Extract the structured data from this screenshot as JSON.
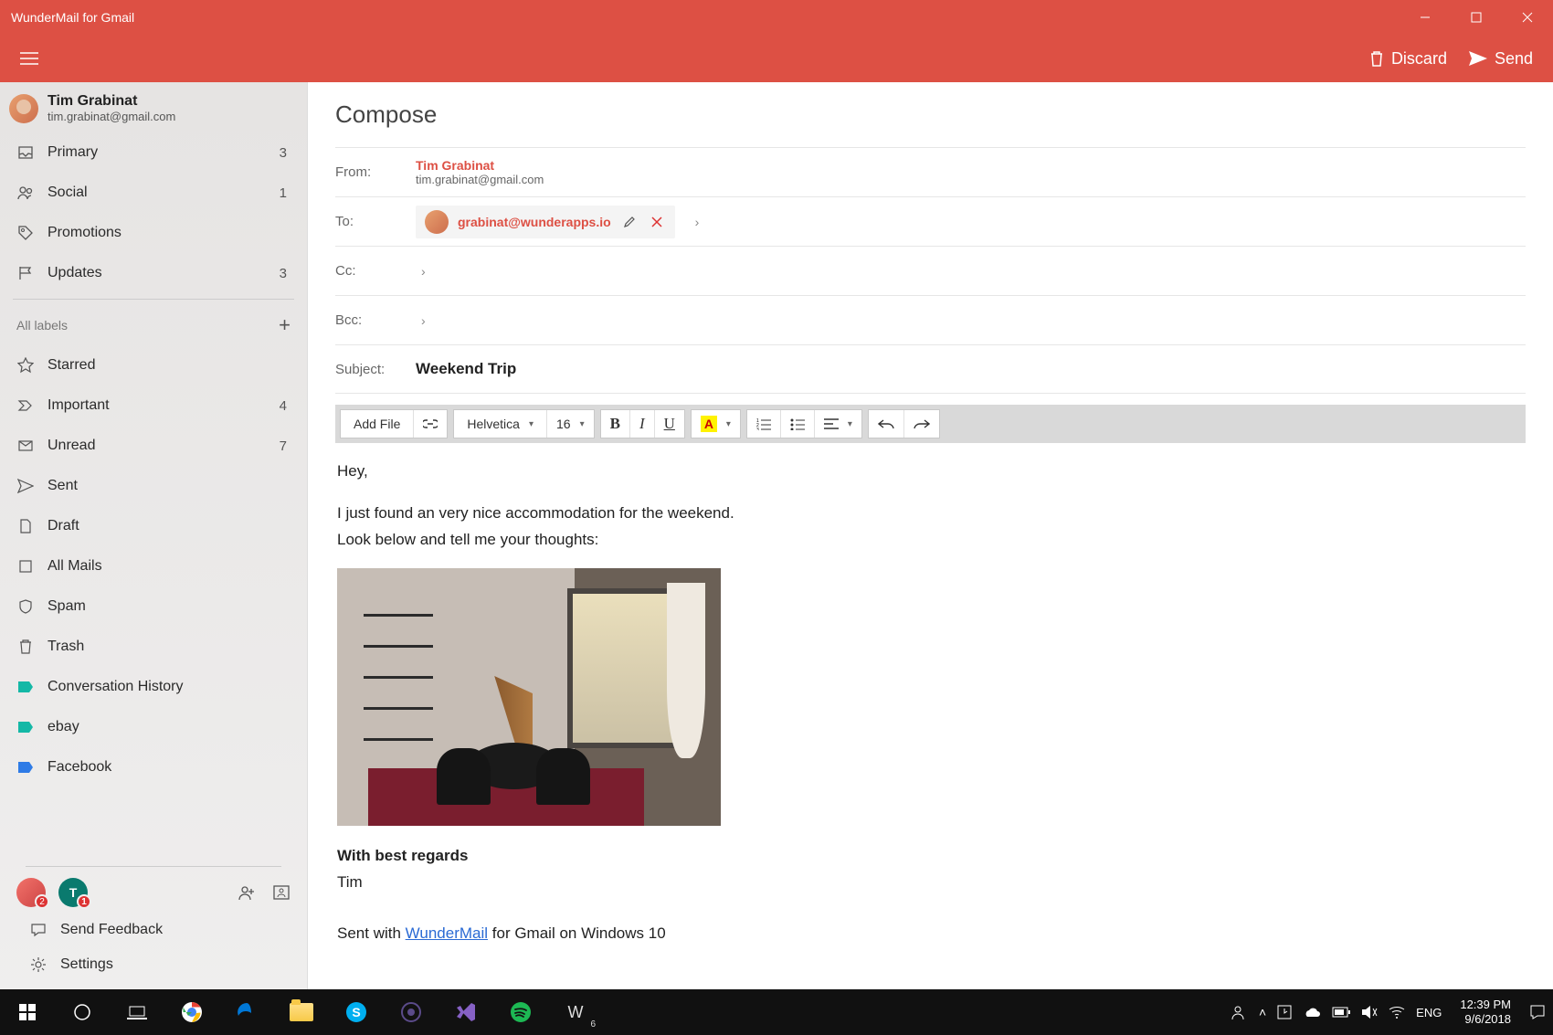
{
  "app": {
    "title": "WunderMail for Gmail"
  },
  "toolbar": {
    "discard": "Discard",
    "send": "Send"
  },
  "account": {
    "name": "Tim Grabinat",
    "email": "tim.grabinat@gmail.com"
  },
  "sidebar": {
    "items": [
      {
        "label": "Primary",
        "count": "3"
      },
      {
        "label": "Social",
        "count": "1"
      },
      {
        "label": "Promotions",
        "count": ""
      },
      {
        "label": "Updates",
        "count": "3"
      }
    ],
    "all_labels": "All labels",
    "system": [
      {
        "label": "Starred",
        "count": ""
      },
      {
        "label": "Important",
        "count": "4"
      },
      {
        "label": "Unread",
        "count": "7"
      },
      {
        "label": "Sent",
        "count": ""
      },
      {
        "label": "Draft",
        "count": ""
      },
      {
        "label": "All Mails",
        "count": ""
      },
      {
        "label": "Spam",
        "count": ""
      },
      {
        "label": "Trash",
        "count": ""
      }
    ],
    "custom": [
      {
        "label": "Conversation History"
      },
      {
        "label": "ebay"
      },
      {
        "label": "Facebook"
      }
    ],
    "avatar_badges": {
      "a": "2",
      "b": "1",
      "b_letter": "T"
    },
    "feedback": "Send Feedback",
    "settings": "Settings"
  },
  "compose": {
    "title": "Compose",
    "from_label": "From:",
    "from_name": "Tim Grabinat",
    "from_email": "tim.grabinat@gmail.com",
    "to_label": "To:",
    "to_chip": "grabinat@wunderapps.io",
    "cc_label": "Cc:",
    "bcc_label": "Bcc:",
    "subject_label": "Subject:",
    "subject_value": "Weekend Trip",
    "editor": {
      "add_file": "Add File",
      "font": "Helvetica",
      "size": "16"
    },
    "body": {
      "greeting": "Hey,",
      "line1": "I just found an very nice accommodation for the weekend.",
      "line2": "Look below and tell me your thoughts:",
      "regards_bold": "With best regards",
      "regards_name": "Tim",
      "sent_with_pre": "Sent with ",
      "sent_with_link": "WunderMail",
      "sent_with_post": " for Gmail on Windows 10"
    }
  },
  "taskbar": {
    "lang": "ENG",
    "time": "12:39 PM",
    "date": "9/6/2018",
    "w_badge": "6"
  }
}
